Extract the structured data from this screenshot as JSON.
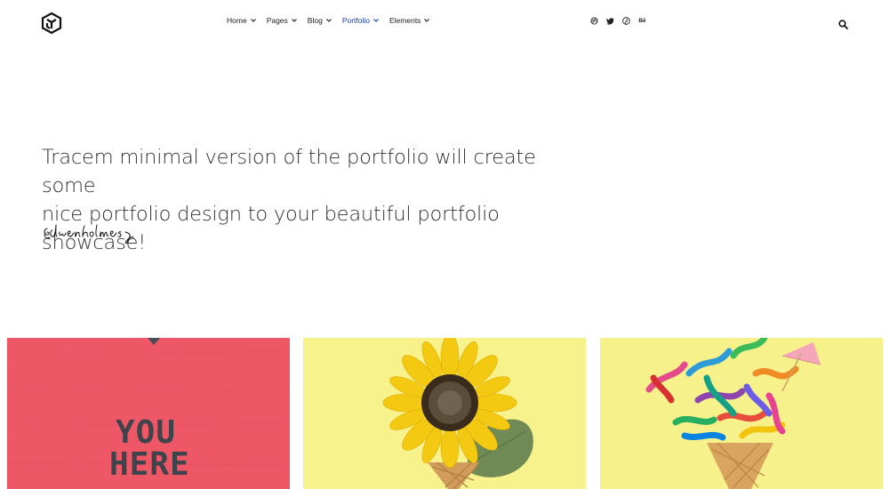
{
  "header": {
    "nav": [
      {
        "label": "Home"
      },
      {
        "label": "Pages"
      },
      {
        "label": "Blog"
      },
      {
        "label": "Portfolio",
        "active": true
      },
      {
        "label": "Elements"
      }
    ],
    "social": [
      {
        "icon": "dribbble-icon"
      },
      {
        "icon": "twitter-icon"
      },
      {
        "icon": "pinterest-icon"
      },
      {
        "icon": "behance-icon",
        "text": "Bē"
      }
    ]
  },
  "hero": {
    "line1": "Tracem minimal version of the portfolio will create some",
    "line2": "nice portfolio design to your beautiful portfolio showcase!",
    "signature": "Edwenholmes"
  },
  "portfolio": {
    "tiles": [
      {
        "name": "you-here",
        "text1": "YOU",
        "text2": "HERE",
        "bg": "#ef5a68"
      },
      {
        "name": "sunflower-cone",
        "bg": "#f7f28b"
      },
      {
        "name": "confetti-cone",
        "bg": "#f7f18c"
      }
    ]
  },
  "colors": {
    "accent": "#1a3fb0",
    "text": "#333333"
  }
}
